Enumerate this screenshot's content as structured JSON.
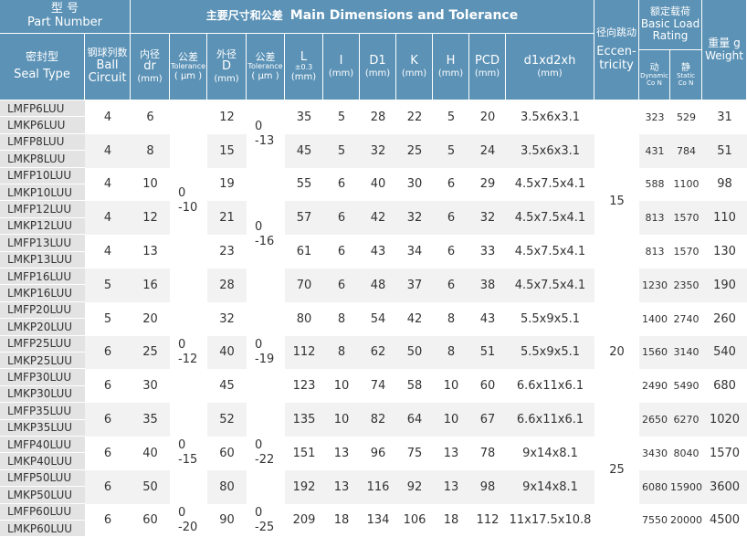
{
  "header": {
    "part_cn": "型  号",
    "part_en": "Part Number",
    "main_title_cn": "主要尺寸和公差",
    "main_title_en": "Main Dimensions and Tolerance",
    "ecc_cn": "径向跳动",
    "ecc_en_1": "Eccen-",
    "ecc_en_2": "tricity",
    "load_cn": "额定载荷",
    "load_en_1": "Basic Load",
    "load_en_2": "Rating",
    "weight_cn": "重量 g",
    "weight_en": "Weight",
    "seal_cn": "密封型",
    "seal_en": "Seal Type",
    "ball_cn": "钢球列数",
    "ball_en_1": "Ball",
    "ball_en_2": "Circuit",
    "dr_cn": "内径",
    "dr_en": "dr",
    "dr_unit": "(mm)",
    "tol1_cn": "公差",
    "tol1_en": "Tolerance",
    "tol1_unit": "( μm )",
    "d_cn": "外径",
    "d_en": "D",
    "d_unit": "(mm)",
    "tol2_cn": "公差",
    "tol2_en": "Tolerance",
    "tol2_unit": "( μm )",
    "l_name": "L",
    "l_tol": "±0.3",
    "l_unit": "(mm)",
    "i_name": "I",
    "i_unit": "(mm)",
    "d1_name": "D1",
    "d1_unit": "(mm)",
    "k_name": "K",
    "k_unit": "(mm)",
    "h_name": "H",
    "h_unit": "(mm)",
    "pcd_name": "PCD",
    "pcd_unit": "(mm)",
    "dxh_name": "d1xd2xh",
    "dxh_unit": "(mm)",
    "dyn_cn": "动",
    "dyn_en": "Dynamic",
    "dyn_unit": "Co N",
    "sta_cn": "静",
    "sta_en": "Static",
    "sta_unit": "Co N"
  },
  "rows": [
    {
      "p1": "LMFP6LUU",
      "p2": "LMKP6LUU",
      "ball": "4",
      "dr": "6",
      "D": "12",
      "L": "35",
      "I": "5",
      "D1": "28",
      "K": "22",
      "H": "5",
      "PCD": "20",
      "dxh": "3.5x6x3.1",
      "dyn": "323",
      "sta": "529",
      "w": "31"
    },
    {
      "p1": "LMFP8LUU",
      "p2": "LMKP8LUU",
      "ball": "4",
      "dr": "8",
      "D": "15",
      "L": "45",
      "I": "5",
      "D1": "32",
      "K": "25",
      "H": "5",
      "PCD": "24",
      "dxh": "3.5x6x3.1",
      "dyn": "431",
      "sta": "784",
      "w": "51"
    },
    {
      "p1": "LMFP10LUU",
      "p2": "LMKP10LUU",
      "ball": "4",
      "dr": "10",
      "D": "19",
      "L": "55",
      "I": "6",
      "D1": "40",
      "K": "30",
      "H": "6",
      "PCD": "29",
      "dxh": "4.5x7.5x4.1",
      "dyn": "588",
      "sta": "1100",
      "w": "98"
    },
    {
      "p1": "LMFP12LUU",
      "p2": "LMKP12LUU",
      "ball": "4",
      "dr": "12",
      "D": "21",
      "L": "57",
      "I": "6",
      "D1": "42",
      "K": "32",
      "H": "6",
      "PCD": "32",
      "dxh": "4.5x7.5x4.1",
      "dyn": "813",
      "sta": "1570",
      "w": "110"
    },
    {
      "p1": "LMFP13LUU",
      "p2": "LMKP13LUU",
      "ball": "4",
      "dr": "13",
      "D": "23",
      "L": "61",
      "I": "6",
      "D1": "43",
      "K": "34",
      "H": "6",
      "PCD": "33",
      "dxh": "4.5x7.5x4.1",
      "dyn": "813",
      "sta": "1570",
      "w": "130"
    },
    {
      "p1": "LMFP16LUU",
      "p2": "LMKP16LUU",
      "ball": "5",
      "dr": "16",
      "D": "28",
      "L": "70",
      "I": "6",
      "D1": "48",
      "K": "37",
      "H": "6",
      "PCD": "38",
      "dxh": "4.5x7.5x4.1",
      "dyn": "1230",
      "sta": "2350",
      "w": "190"
    },
    {
      "p1": "LMFP20LUU",
      "p2": "LMKP20LUU",
      "ball": "5",
      "dr": "20",
      "D": "32",
      "L": "80",
      "I": "8",
      "D1": "54",
      "K": "42",
      "H": "8",
      "PCD": "43",
      "dxh": "5.5x9x5.1",
      "dyn": "1400",
      "sta": "2740",
      "w": "260"
    },
    {
      "p1": "LMFP25LUU",
      "p2": "LMKP25LUU",
      "ball": "6",
      "dr": "25",
      "D": "40",
      "L": "112",
      "I": "8",
      "D1": "62",
      "K": "50",
      "H": "8",
      "PCD": "51",
      "dxh": "5.5x9x5.1",
      "dyn": "1560",
      "sta": "3140",
      "w": "540"
    },
    {
      "p1": "LMFP30LUU",
      "p2": "LMKP30LUU",
      "ball": "6",
      "dr": "30",
      "D": "45",
      "L": "123",
      "I": "10",
      "D1": "74",
      "K": "58",
      "H": "10",
      "PCD": "60",
      "dxh": "6.6x11x6.1",
      "dyn": "2490",
      "sta": "5490",
      "w": "680"
    },
    {
      "p1": "LMFP35LUU",
      "p2": "LMKP35LUU",
      "ball": "6",
      "dr": "35",
      "D": "52",
      "L": "135",
      "I": "10",
      "D1": "82",
      "K": "64",
      "H": "10",
      "PCD": "67",
      "dxh": "6.6x11x6.1",
      "dyn": "2650",
      "sta": "6270",
      "w": "1020"
    },
    {
      "p1": "LMFP40LUU",
      "p2": "LMKP40LUU",
      "ball": "6",
      "dr": "40",
      "D": "60",
      "L": "151",
      "I": "13",
      "D1": "96",
      "K": "75",
      "H": "13",
      "PCD": "78",
      "dxh": "9x14x8.1",
      "dyn": "3430",
      "sta": "8040",
      "w": "1570"
    },
    {
      "p1": "LMFP50LUU",
      "p2": "LMKP50LUU",
      "ball": "6",
      "dr": "50",
      "D": "80",
      "L": "192",
      "I": "13",
      "D1": "116",
      "K": "92",
      "H": "13",
      "PCD": "98",
      "dxh": "9x14x8.1",
      "dyn": "6080",
      "sta": "15900",
      "w": "3600"
    },
    {
      "p1": "LMFP60LUU",
      "p2": "LMKP60LUU",
      "ball": "6",
      "dr": "60",
      "D": "90",
      "L": "209",
      "I": "18",
      "D1": "134",
      "K": "106",
      "H": "18",
      "PCD": "112",
      "dxh": "11x17.5x10.8",
      "dyn": "7550",
      "sta": "20000",
      "w": "4500"
    }
  ],
  "tol_dr": [
    {
      "rows": [
        0,
        5
      ],
      "top": "0",
      "bottom": "-10"
    },
    {
      "rows": [
        6,
        8
      ],
      "top": "0",
      "bottom": "-12"
    },
    {
      "rows": [
        9,
        11
      ],
      "top": "0",
      "bottom": "-15"
    },
    {
      "rows": [
        12,
        12
      ],
      "top": "0",
      "bottom": "-20"
    }
  ],
  "tol_D": [
    {
      "rows": [
        0,
        1
      ],
      "top": "0",
      "bottom": "-13"
    },
    {
      "rows": [
        2,
        5
      ],
      "top": "0",
      "bottom": "-16"
    },
    {
      "rows": [
        6,
        8
      ],
      "top": "0",
      "bottom": "-19"
    },
    {
      "rows": [
        9,
        11
      ],
      "top": "0",
      "bottom": "-22"
    },
    {
      "rows": [
        12,
        12
      ],
      "top": "0",
      "bottom": "-25"
    }
  ],
  "ecc": [
    {
      "rows": [
        0,
        5
      ],
      "value": "15"
    },
    {
      "rows": [
        6,
        8
      ],
      "value": "20"
    },
    {
      "rows": [
        9,
        12
      ],
      "value": "25"
    }
  ],
  "colors": {
    "header_bg": "#5b92b6",
    "header_text": "#ffffff",
    "part_col_bg": "#e3e3e3",
    "band_bg": "#f2f2f2",
    "text": "#333333"
  }
}
